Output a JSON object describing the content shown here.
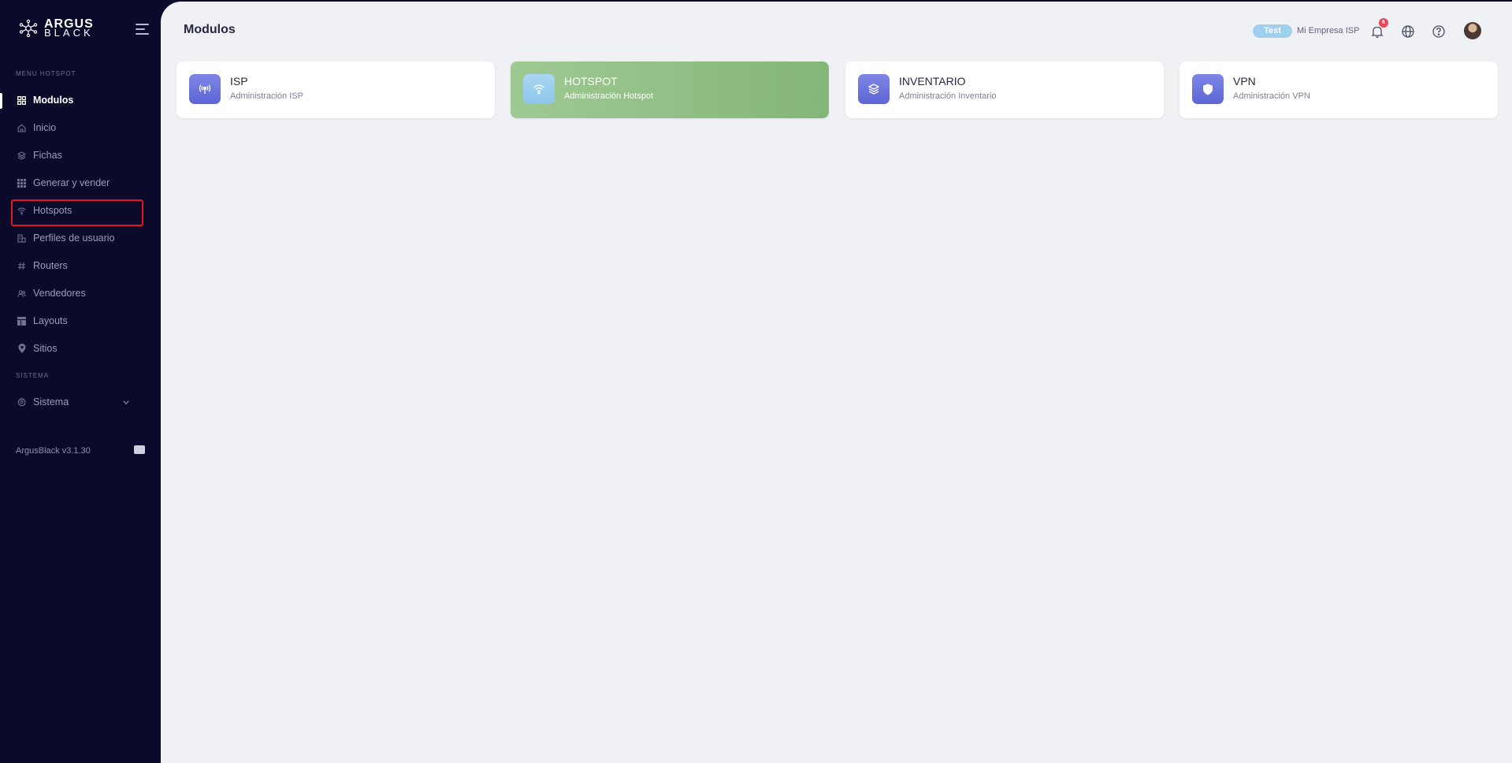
{
  "brand": {
    "line1": "ARGUS",
    "line2": "BLACK"
  },
  "sidebar": {
    "section_menu": "MENU HOTSPOT",
    "items": [
      {
        "label": "Modulos",
        "icon": "grid-icon"
      },
      {
        "label": "Inicio",
        "icon": "home-icon"
      },
      {
        "label": "Fichas",
        "icon": "layers-icon"
      },
      {
        "label": "Generar y vender",
        "icon": "apps-icon"
      },
      {
        "label": "Hotspots",
        "icon": "wifi-icon"
      },
      {
        "label": "Perfiles de usuario",
        "icon": "profiles-icon"
      },
      {
        "label": "Routers",
        "icon": "hash-icon"
      },
      {
        "label": "Vendedores",
        "icon": "users-icon"
      },
      {
        "label": "Layouts",
        "icon": "layout-icon"
      },
      {
        "label": "Sitios",
        "icon": "pin-icon"
      }
    ],
    "section_system": "SISTEMA",
    "system_item": {
      "label": "Sistema",
      "icon": "gear-icon"
    },
    "version": "ArgusBlack v3.1.30"
  },
  "header": {
    "title": "Modulos",
    "env_badge": "Test",
    "company": "Mi Empresa ISP",
    "notification_count": "6"
  },
  "modules": [
    {
      "title": "ISP",
      "subtitle": "Administración ISP",
      "icon": "broadcast-icon",
      "active": false
    },
    {
      "title": "HOTSPOT",
      "subtitle": "Administración Hotspot",
      "icon": "wifi-icon",
      "active": true
    },
    {
      "title": "INVENTARIO",
      "subtitle": "Administración Inventario",
      "icon": "box-icon",
      "active": false
    },
    {
      "title": "VPN",
      "subtitle": "Administración VPN",
      "icon": "shield-icon",
      "active": false
    }
  ],
  "colors": {
    "sidebar_bg": "#0b0a2a",
    "main_bg": "#f0f1f5",
    "accent_purple": "#5c65d4",
    "active_card_green": "#9fc993",
    "highlight_red": "#e3171b",
    "badge_blue": "#9fd0ee"
  }
}
